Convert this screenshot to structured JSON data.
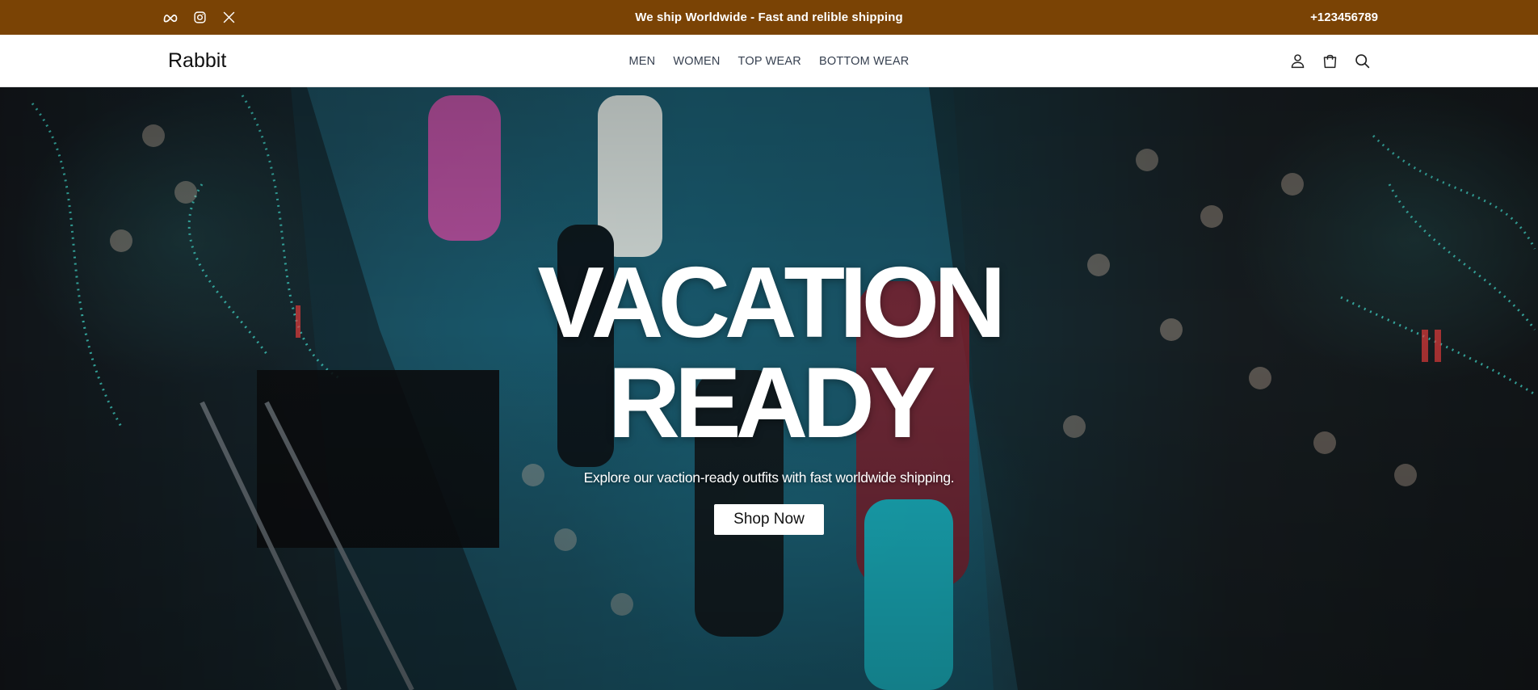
{
  "topbar": {
    "announcement": "We ship Worldwide - Fast and relible shipping",
    "phone": "+123456789",
    "socials": [
      "meta-icon",
      "instagram-icon",
      "x-icon"
    ],
    "background_color": "#7a4305"
  },
  "navbar": {
    "logo": "Rabbit",
    "menu": [
      {
        "label": "MEN"
      },
      {
        "label": "WOMEN"
      },
      {
        "label": "TOP WEAR"
      },
      {
        "label": "BOTTOM WEAR"
      }
    ],
    "actions": [
      "user-icon",
      "shopping-bag-icon",
      "search-icon"
    ]
  },
  "hero": {
    "title_line1": "VACATION",
    "title_line2": "READY",
    "subtitle": "Explore our vaction-ready outfits with fast worldwide shipping.",
    "cta_label": "Shop Now"
  }
}
